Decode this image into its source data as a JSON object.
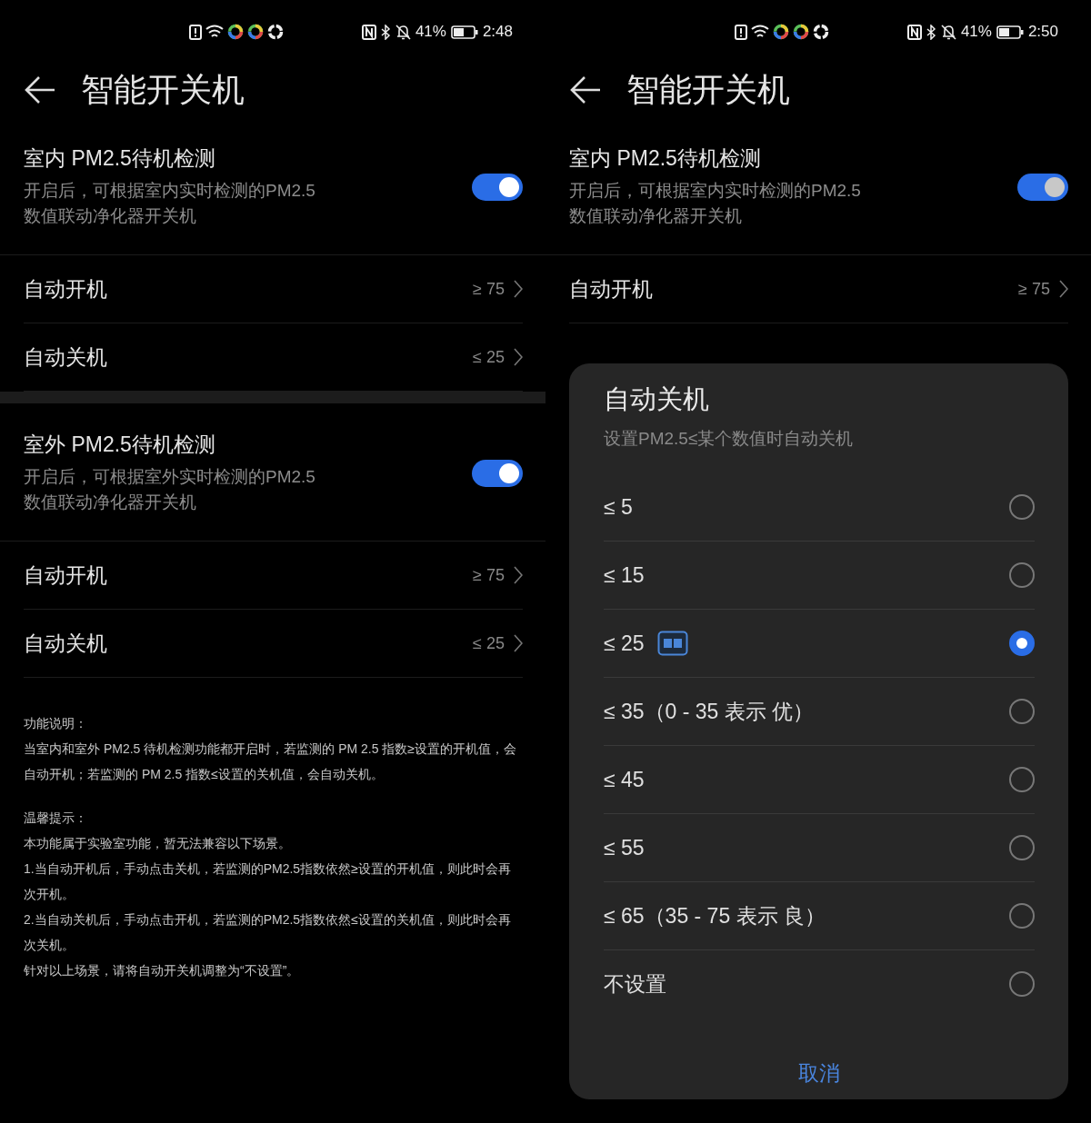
{
  "screens": [
    {
      "status_bar": {
        "battery": "41%",
        "time": "2:48"
      },
      "title": "智能开关机",
      "sections": [
        {
          "title": "室内 PM2.5待机检测",
          "description": "开启后，可根据室内实时检测的PM2.5\n数值联动净化器开关机",
          "on": true,
          "rows": [
            {
              "label": "自动开机",
              "value": "≥ 75"
            },
            {
              "label": "自动关机",
              "value": "≤ 25"
            }
          ]
        },
        {
          "title": "室外 PM2.5待机检测",
          "description": "开启后，可根据室外实时检测的PM2.5\n数值联动净化器开关机",
          "on": true,
          "rows": [
            {
              "label": "自动开机",
              "value": "≥ 75"
            },
            {
              "label": "自动关机",
              "value": "≤ 25"
            }
          ]
        }
      ],
      "notes": [
        {
          "heading": "功能说明：",
          "lines": [
            "当室内和室外 PM2.5 待机检测功能都开启时，若监测的 PM 2.5 指数≥设置的开机值，会自动开机；若监测的 PM 2.5 指数≤设置的关机值，会自动关机。"
          ]
        },
        {
          "heading": "温馨提示：",
          "lines": [
            "本功能属于实验室功能，暂无法兼容以下场景。",
            "1.当自动开机后，手动点击关机，若监测的PM2.5指数依然≥设置的开机值，则此时会再次开机。",
            "2.当自动关机后，手动点击开机，若监测的PM2.5指数依然≤设置的关机值，则此时会再次关机。",
            "针对以上场景，请将自动开关机调整为“不设置”。"
          ]
        }
      ]
    },
    {
      "status_bar": {
        "battery": "41%",
        "time": "2:50"
      },
      "title": "智能开关机",
      "sections": [
        {
          "title": "室内 PM2.5待机检测",
          "description": "开启后，可根据室内实时检测的PM2.5\n数值联动净化器开关机",
          "on": true,
          "rows": [
            {
              "label": "自动开机",
              "value": "≥ 75"
            }
          ]
        }
      ],
      "dialog": {
        "title": "自动关机",
        "subtitle": "设置PM2.5≤某个数值时自动关机",
        "options": [
          {
            "label": "≤ 5",
            "badge": false,
            "selected": false
          },
          {
            "label": "≤ 15",
            "badge": false,
            "selected": false
          },
          {
            "label": "≤ 25",
            "badge": true,
            "selected": true
          },
          {
            "label": "≤ 35（0 - 35 表示 优）",
            "badge": false,
            "selected": false
          },
          {
            "label": "≤ 45",
            "badge": false,
            "selected": false
          },
          {
            "label": "≤ 55",
            "badge": false,
            "selected": false
          },
          {
            "label": "≤ 65（35 - 75 表示 良）",
            "badge": false,
            "selected": false
          },
          {
            "label": "不设置",
            "badge": false,
            "selected": false
          }
        ],
        "cancel": "取消"
      }
    }
  ]
}
